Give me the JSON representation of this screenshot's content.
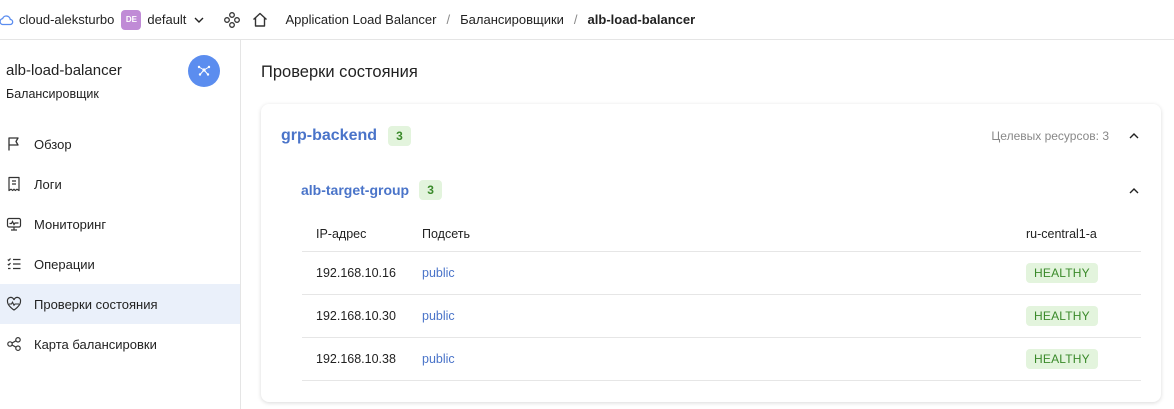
{
  "topbar": {
    "cloud_name": "cloud-aleksturbo",
    "folder_badge": "DE",
    "folder_name": "default",
    "breadcrumbs": [
      {
        "label": "Application Load Balancer"
      },
      {
        "label": "Балансировщики"
      },
      {
        "label": "alb-load-balancer"
      }
    ],
    "separator": "/"
  },
  "sidebar": {
    "title": "alb-load-balancer",
    "subtitle": "Балансировщик",
    "action_icon": "network-icon",
    "items": [
      {
        "label": "Обзор",
        "icon": "flag-icon",
        "active": false
      },
      {
        "label": "Логи",
        "icon": "receipt-icon",
        "active": false
      },
      {
        "label": "Мониторинг",
        "icon": "monitor-icon",
        "active": false
      },
      {
        "label": "Операции",
        "icon": "list-check-icon",
        "active": false
      },
      {
        "label": "Проверки состояния",
        "icon": "heart-pulse-icon",
        "active": true
      },
      {
        "label": "Карта балансировки",
        "icon": "share-nodes-icon",
        "active": false
      }
    ]
  },
  "main": {
    "page_title": "Проверки состояния",
    "backend_group": {
      "name": "grp-backend",
      "count": "3",
      "targets_text": "Целевых ресурсов: 3",
      "target_group": {
        "name": "alb-target-group",
        "count": "3",
        "columns": [
          "IP-адрес",
          "Подсеть",
          "ru-central1-a"
        ],
        "rows": [
          {
            "ip": "192.168.10.16",
            "subnet": "public",
            "status": "HEALTHY"
          },
          {
            "ip": "192.168.10.30",
            "subnet": "public",
            "status": "HEALTHY"
          },
          {
            "ip": "192.168.10.38",
            "subnet": "public",
            "status": "HEALTHY"
          }
        ]
      }
    }
  },
  "colors": {
    "accent": "#4a74c9",
    "action_button": "#5b8def",
    "healthy_bg": "#e3f4dd",
    "healthy_text": "#3a8a2a",
    "active_nav_bg": "#eaf0fa",
    "folder_badge_bg": "#c08bd6"
  }
}
